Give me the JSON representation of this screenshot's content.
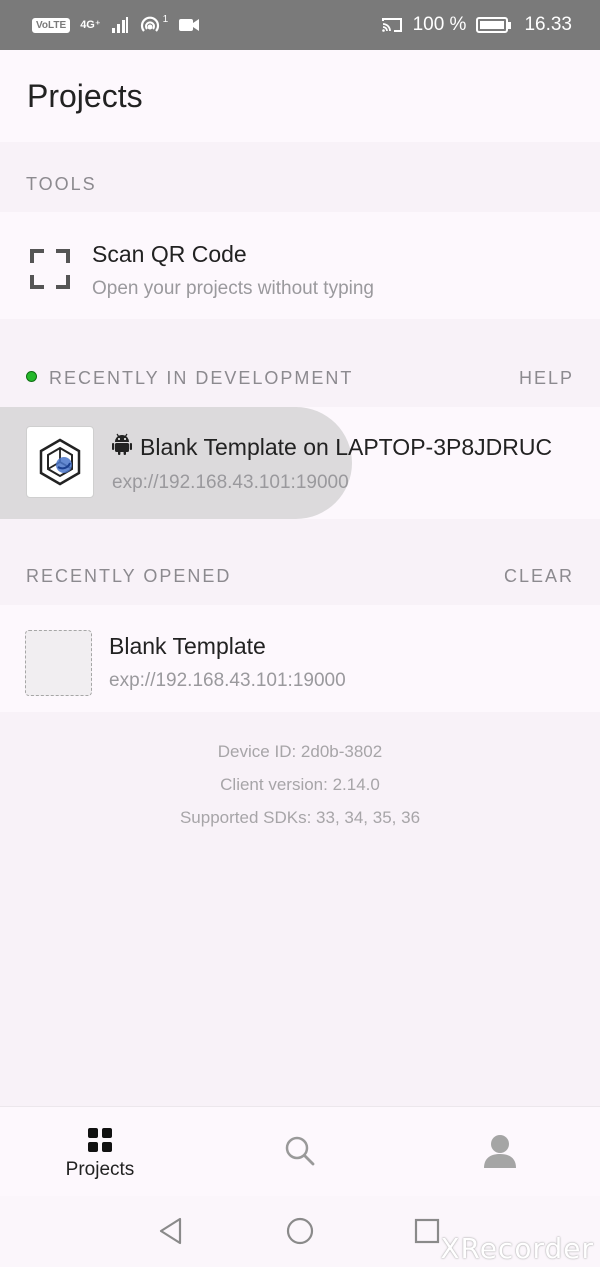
{
  "status_bar": {
    "volte": "VoLTE",
    "network": "4G⁺",
    "hotspot_count": "1",
    "battery": "100 %",
    "time": "16.33"
  },
  "header": {
    "title": "Projects"
  },
  "tools": {
    "section_label": "TOOLS",
    "scan": {
      "title": "Scan QR Code",
      "subtitle": "Open your projects without typing"
    }
  },
  "development": {
    "section_label": "RECENTLY IN DEVELOPMENT",
    "action": "HELP",
    "status_color": "#25b82b",
    "project": {
      "title": "Blank Template on LAPTOP-3P8JDRUC",
      "url": "exp://192.168.43.101:19000",
      "platform_icon": "android-icon"
    }
  },
  "recent": {
    "section_label": "RECENTLY OPENED",
    "action": "CLEAR",
    "project": {
      "title": "Blank Template",
      "url": "exp://192.168.43.101:19000"
    }
  },
  "meta": {
    "device_id": "Device ID: 2d0b-3802",
    "client_version": "Client version: 2.14.0",
    "sdks": "Supported SDKs: 33, 34, 35, 36"
  },
  "bottom_nav": {
    "projects_label": "Projects"
  },
  "watermark": "XRecorder"
}
